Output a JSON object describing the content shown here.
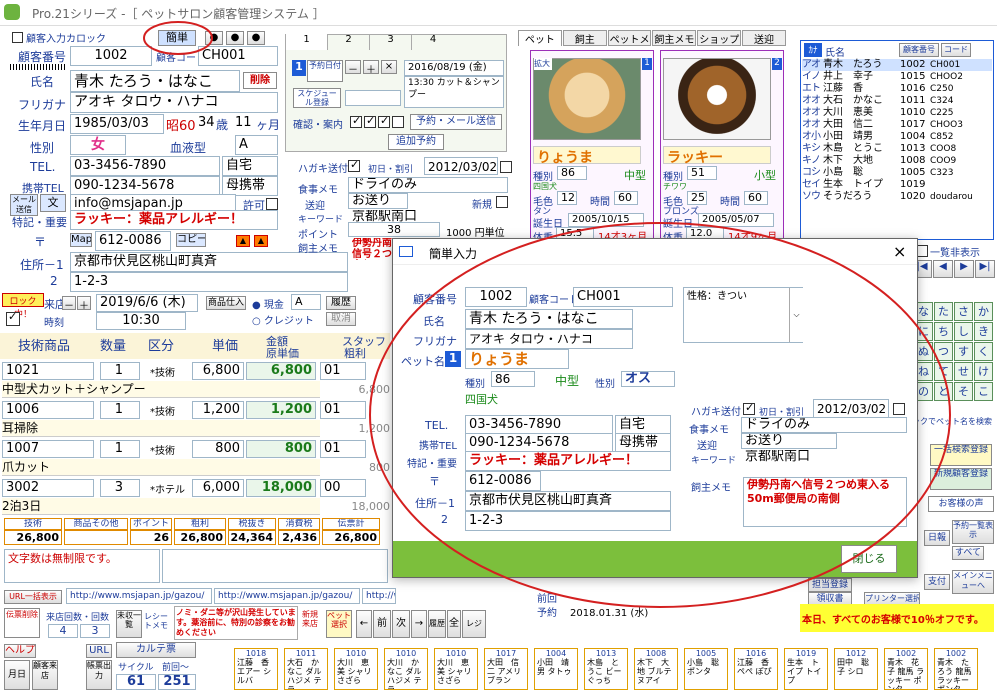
{
  "window": {
    "title": "Pro.21シリーズ  -［ ペットサロン顧客管理システム ］"
  },
  "header": {
    "customer_card": "顧客入力カロック",
    "simple_entry": "簡単"
  },
  "customer": {
    "no_label": "顧客番号",
    "no": "1002",
    "code_label": "顧客コード",
    "code": "CH001",
    "name_label": "氏名",
    "name": "青木 たろう・はなこ",
    "delete": "削除",
    "kana_label": "フリガナ",
    "kana": "アオキ タロウ・ハナコ",
    "birth_label": "生年月日",
    "birth": "1985/03/03",
    "era": "昭60",
    "age": "34",
    "age_unit": "歳",
    "months": "11",
    "months_unit": "ヶ月",
    "gender_label": "性別",
    "gender": "女",
    "blood_label": "血液型",
    "blood": "A",
    "tel_label": "TEL.",
    "tel": "03-3456-7890",
    "tel_type": "自宅",
    "mobile_label": "携帯TEL",
    "mobile": "090-1234-5678",
    "mobile_type": "母携帯",
    "mail_btn": "メール送信",
    "text_btn": "文",
    "email": "info@msjapan.jp",
    "permit": "許可",
    "note_label": "特記・重要",
    "note": "ラッキー：薬品アレルギー！",
    "zip_label": "〒",
    "map": "Map",
    "zip": "612-0086",
    "copy": "コピー",
    "addr1_label": "住所－1",
    "addr1": "京都市伏見区桃山町真斉",
    "addr2_label": "2",
    "addr2": "1-2-3"
  },
  "booking": {
    "tabs": [
      "1",
      "2",
      "3",
      "4"
    ],
    "slot": "1",
    "reserve_date": "予約日付",
    "schedule": "スケジュール登録",
    "date": "2016/08/19 (金)",
    "detail": "13:30 カット＆シャンプー",
    "confirm_label": "確認・案内",
    "send_btn": "予約・メール送信",
    "add_btn": "追加予約"
  },
  "postcard": {
    "label": "ハガキ送付",
    "first_label": "初日・割引",
    "date": "2012/03/02",
    "food_label": "食事メモ",
    "food": "ドライのみ",
    "send_label": "送迎",
    "send": "お送り",
    "new_label": "新規",
    "keyword_label": "キーワード",
    "keyword": "京都駅南口",
    "point_label": "ポイント",
    "point": "38",
    "point_unit": "1000 円単位",
    "owner_memo_label": "飼主メモ",
    "owner_memo": "伊勢丹南へ信号２つめ東入る50m郵便局の南側"
  },
  "pet_tabs": [
    "ペット",
    "飼主",
    "ペットメモ",
    "飼主メモ",
    "ショップ",
    "送迎"
  ],
  "pets": [
    {
      "no": "1",
      "name": "りょうま",
      "kind_label": "種別",
      "kind": "86",
      "size": "中型",
      "breed": "四国犬",
      "color_label": "毛色",
      "color": "12",
      "time_label": "時間",
      "time": "60",
      "color_name": "タン",
      "birth_label": "誕生日",
      "birth": "2005/10/15",
      "weight_label": "体重",
      "weight": "15.5",
      "age": "14才3ヶ月",
      "enlarge": "拡大"
    },
    {
      "no": "2",
      "name": "ラッキー",
      "kind_label": "種別",
      "kind": "51",
      "size": "小型",
      "breed": "チワワ",
      "color_label": "毛色",
      "color": "25",
      "time_label": "時間",
      "time": "60",
      "color_name": "ブロンズ",
      "birth_label": "誕生日",
      "birth": "2005/05/07",
      "weight_label": "体重",
      "weight": "12.0",
      "age": "14才9ヶ月"
    }
  ],
  "list": {
    "title_tab": "ｶﾅ",
    "name_hdr": "氏名",
    "no_hdr": "顧客番号",
    "code_hdr": "コード",
    "rows": [
      {
        "k": "ア",
        "s": "オ",
        "name": "青木　たろう",
        "no": "1002",
        "code": "CH001"
      },
      {
        "k": "イ",
        "s": "ノ",
        "name": "井上　幸子",
        "no": "1015",
        "code": "CHOO2"
      },
      {
        "k": "エ",
        "s": "ト",
        "name": "江藤　香",
        "no": "1016",
        "code": "C250"
      },
      {
        "k": "オ",
        "s": "オ",
        "name": "大石　かなこ",
        "no": "1011",
        "code": "C324"
      },
      {
        "k": "オ",
        "s": "オ",
        "name": "大川　恵美",
        "no": "1010",
        "code": "C225"
      },
      {
        "k": "オ",
        "s": "オ",
        "name": "大田　信二",
        "no": "1017",
        "code": "CHOO3"
      },
      {
        "k": "オ",
        "s": "小",
        "name": "小田　靖男",
        "no": "1004",
        "code": "C852"
      },
      {
        "k": "キ",
        "s": "シ",
        "name": "木島　とうこ",
        "no": "1013",
        "code": "COO8"
      },
      {
        "k": "キ",
        "s": "ノ",
        "name": "木下　大地",
        "no": "1008",
        "code": "COO9"
      },
      {
        "k": "コ",
        "s": "シ",
        "name": "小島　聡",
        "no": "1005",
        "code": "C323"
      },
      {
        "k": "セ",
        "s": "イ",
        "name": "生本　トイプ",
        "no": "1019",
        "code": ""
      },
      {
        "k": "ソ",
        "s": "ウ",
        "name": "そうだろう",
        "no": "1020",
        "code": "doudarou"
      }
    ],
    "show_all": "一覧非表示"
  },
  "kana_keys": [
    "な",
    "た",
    "さ",
    "か",
    "に",
    "ち",
    "し",
    "き",
    "ぬ",
    "つ",
    "す",
    "く",
    "ね",
    "て",
    "せ",
    "け",
    "の",
    "と",
    "そ",
    "こ"
  ],
  "side": {
    "search_hint": "ックでペット名を検索",
    "bulk": "一括検索登録",
    "new": "新規顧客登録",
    "voice": "お客様の声",
    "day": "日報",
    "all": "すべて",
    "rsv": "予約一覧表示",
    "pay": "支付",
    "menu": "メインメニューへ",
    "staff": "担当登録",
    "receipt": "領収書",
    "printer": "プリンター選択",
    "notice": "本日、すべてのお客様で10％オフです。"
  },
  "sales": {
    "lock": "ロック中！",
    "store_label": "来店日",
    "date": "2019/6/6 (木)",
    "time": "10:30",
    "time_label": "時刻",
    "goods": "商品仕入",
    "cash": "現金",
    "credit": "クレジット",
    "rank": "A",
    "history": "履歴",
    "cancel": "取消",
    "headers": [
      "技術商品",
      "数量",
      "区分",
      "単価",
      "金額",
      "原単価",
      "スタッフ",
      "粗利"
    ],
    "rows": [
      {
        "code": "1021",
        "qty": "1",
        "type": "*技術",
        "price": "6,800",
        "amount": "6,800",
        "staff": "01",
        "gross": "6,800",
        "item": "中型犬カット＋シャンプー"
      },
      {
        "code": "1006",
        "qty": "1",
        "type": "*技術",
        "price": "1,200",
        "amount": "1,200",
        "staff": "01",
        "gross": "1,200",
        "item": "耳掃除"
      },
      {
        "code": "1007",
        "qty": "1",
        "type": "*技術",
        "price": "800",
        "amount": "800",
        "staff": "01",
        "gross": "800",
        "item": "爪カット"
      },
      {
        "code": "3002",
        "qty": "3",
        "type": "*ホテル",
        "price": "6,000",
        "amount": "18,000",
        "staff": "00",
        "gross": "18,000",
        "item": "2泊3日"
      }
    ],
    "totals_hdr": [
      "技術",
      "商品その他",
      "ポイント",
      "粗利",
      "税抜き",
      "消費税",
      "伝票計"
    ],
    "totals": [
      "26,800",
      "",
      "26",
      "26,800",
      "24,364",
      "2,436",
      "26,800"
    ],
    "memo_hint": "文字数は無制限です。"
  },
  "urls": {
    "label": "URL一括表示",
    "u1": "http://www.msjapan.jp/gazou/",
    "u2": "http://www.msjapan.jp/gazou/",
    "u3": "http://www.msjapan.jp/gazou/"
  },
  "bottom": {
    "slip_del": "伝票削除",
    "visits": "来店回数・回数",
    "visits_v": "4",
    "count": "3",
    "unpaid": "未収一覧",
    "receipt": "レシートメモ",
    "note": "ノミ・ダニ等が沢山発生しています。薬浴前に、特別の診察をお勧めください",
    "new_visit": "新規来店",
    "pet_select": "ペット選択",
    "help": "ヘルプ",
    "url": "URL",
    "karte": "カルテ票",
    "monthly": "月日",
    "customer_info": "顧客来店",
    "record": "帳票出力",
    "cycle": "サイクル",
    "prev": "前回～",
    "cycle_v": "61",
    "prev_v": "251",
    "last_label": "前回",
    "last_date": "2018.01.31 (水)",
    "rsv_label": "予約"
  },
  "footer_cards": [
    {
      "no": "1018",
      "t": "江藤　香 エアー シルバ"
    },
    {
      "no": "1011",
      "t": "大石　かなこ ダル ハジメ テラ"
    },
    {
      "no": "1010",
      "t": "大川　恵美 シャリ さざら"
    },
    {
      "no": "1010",
      "t": "大川　かなこ ダル ハジメ テラ"
    },
    {
      "no": "1010",
      "t": "大川　恵美 シャリ さざら"
    },
    {
      "no": "1017",
      "t": "大田　信二 アメリ ブラン"
    },
    {
      "no": "1004",
      "t": "小田　靖男 タトゥ"
    },
    {
      "no": "1013",
      "t": "木島　とうこ ビー ぐっち"
    },
    {
      "no": "1008",
      "t": "木下　大地 ブルテ ヌアイ"
    },
    {
      "no": "1005",
      "t": "小島　聡 ポンタ"
    },
    {
      "no": "1016",
      "t": "江藤　香 ぺぺ ぽぴ"
    },
    {
      "no": "1019",
      "t": "生本　トイプ トイプ"
    },
    {
      "no": "1012",
      "t": "田中　聡子 シロ"
    },
    {
      "no": "1002",
      "t": "青木　花子 龍馬 ラッキー ポンタ"
    },
    {
      "no": "1002",
      "t": "青木　たろう 龍馬 ラッキー ポンタ"
    }
  ],
  "dialog": {
    "title": "簡単入力",
    "close_x": "×",
    "no_label": "顧客番号",
    "no": "1002",
    "code_label": "顧客コード",
    "code": "CH001",
    "name_label": "氏名",
    "name": "青木 たろう・はなこ",
    "kana_label": "フリガナ",
    "kana": "アオキ タロウ・ハナコ",
    "character_label": "性格：きつい",
    "pet_label": "ペット名",
    "pet_no": "1",
    "pet_name": "りょうま",
    "kind_label": "種別",
    "kind": "86",
    "size": "中型",
    "sex_label": "性別",
    "sex": "オス",
    "breed": "四国犬",
    "tel_label": "TEL.",
    "tel": "03-3456-7890",
    "tel_type": "自宅",
    "mobile_label": "携帯TEL",
    "mobile": "090-1234-5678",
    "mobile_type": "母携帯",
    "note_label": "特記・重要",
    "note": "ラッキー：薬品アレルギー！",
    "zip_label": "〒",
    "zip": "612-0086",
    "addr1_label": "住所－1",
    "addr1": "京都市伏見区桃山町真斉",
    "addr2_label": "2",
    "addr2": "1-2-3",
    "postcard_label": "ハガキ送付",
    "first_label": "初日・割引",
    "date": "2012/03/02",
    "food_label": "食事メモ",
    "food": "ドライのみ",
    "send_label": "送迎",
    "send": "お送り",
    "keyword_label": "キーワード",
    "keyword": "京都駅南口",
    "owner_memo_label": "飼主メモ",
    "owner_memo": "伊勢丹南へ信号２つめ東入る50m郵便局の南側",
    "close_btn": "閉じる"
  }
}
